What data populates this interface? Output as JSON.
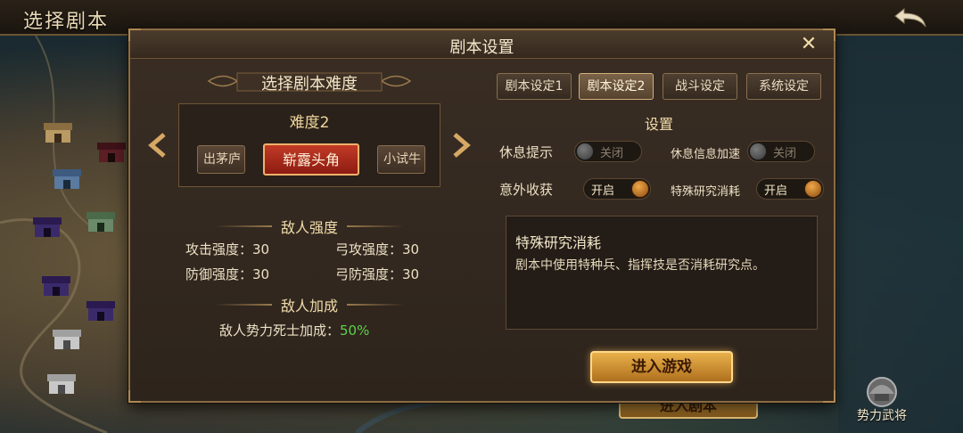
{
  "top_bar": {
    "title": "选择剧本"
  },
  "background": {
    "enter_script_label": "进入剧本",
    "force_general_label": "势力武将"
  },
  "dialog": {
    "title": "剧本设置",
    "difficulty": {
      "banner": "选择剧本难度",
      "level_label": "难度2",
      "options": {
        "left": "出茅庐",
        "selected": "崭露头角",
        "right": "小试牛"
      }
    },
    "enemy_strength": {
      "heading": "敌人强度",
      "stats": [
        {
          "label": "攻击强度：",
          "value": "30"
        },
        {
          "label": "弓攻强度：",
          "value": "30"
        },
        {
          "label": "防御强度：",
          "value": "30"
        },
        {
          "label": "弓防强度：",
          "value": "30"
        }
      ]
    },
    "enemy_bonus": {
      "heading": "敌人加成",
      "label": "敌人势力死士加成：",
      "value": "50%"
    },
    "tabs": [
      "剧本设定1",
      "剧本设定2",
      "战斗设定",
      "系统设定"
    ],
    "active_tab": "剧本设定2",
    "settings": {
      "heading": "设置",
      "items": [
        {
          "label": "休息提示",
          "state": "关闭"
        },
        {
          "label": "休息信息加速",
          "state": "关闭"
        },
        {
          "label": "意外收获",
          "state": "开启"
        },
        {
          "label": "特殊研究消耗",
          "state": "开启"
        }
      ]
    },
    "description": {
      "title": "特殊研究消耗",
      "text": "剧本中使用特种兵、指挥技是否消耗研究点。"
    },
    "enter_button": "进入游戏"
  },
  "colors": {
    "accent_red": "#c23a26",
    "accent_gold": "#e8b04a",
    "bonus_green": "#5fd04c"
  },
  "icons": [
    "back-arrow-icon",
    "close-icon",
    "chevron-left-icon",
    "chevron-right-icon",
    "helmet-icon",
    "castle-icon"
  ]
}
